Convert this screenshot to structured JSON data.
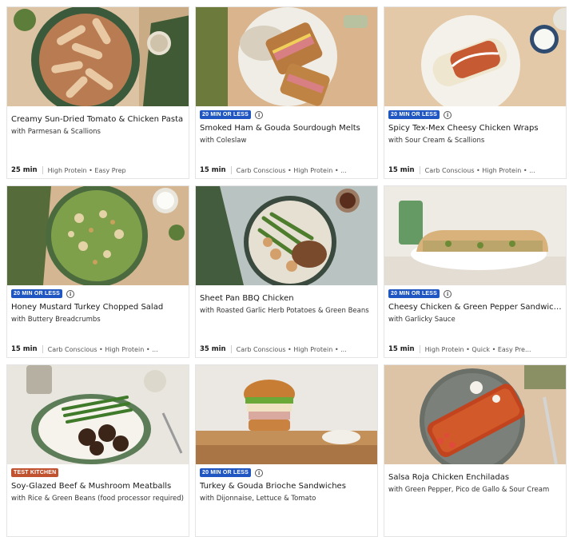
{
  "colors": {
    "badge_quick": "#1f56c2",
    "badge_test_kitchen": "#c0522f",
    "card_border": "#e4e4e4"
  },
  "cards": [
    {
      "title": "Creamy Sun-Dried Tomato & Chicken Pasta",
      "subtitle": "with Parmesan & Scallions",
      "time": "25 min",
      "tags": "High Protein • Easy Prep",
      "badge": ""
    },
    {
      "title": "Smoked Ham & Gouda Sourdough Melts",
      "subtitle": "with Coleslaw",
      "time": "15 min",
      "tags": "Carb Conscious • High Protein • ...",
      "badge": "20 MIN OR LESS"
    },
    {
      "title": "Spicy Tex-Mex Cheesy Chicken Wraps",
      "subtitle": "with Sour Cream & Scallions",
      "time": "15 min",
      "tags": "Carb Conscious • High Protein • ...",
      "badge": "20 MIN OR LESS"
    },
    {
      "title": "Honey Mustard Turkey Chopped Salad",
      "subtitle": "with Buttery Breadcrumbs",
      "time": "15 min",
      "tags": "Carb Conscious • High Protein • ...",
      "badge": "20 MIN OR LESS"
    },
    {
      "title": "Sheet Pan BBQ Chicken",
      "subtitle": "with Roasted Garlic Herb Potatoes & Green Beans",
      "time": "35 min",
      "tags": "Carb Conscious • High Protein • ...",
      "badge": ""
    },
    {
      "title": "Cheesy Chicken & Green Pepper Sandwich...",
      "subtitle": "with Garlicky Sauce",
      "time": "15 min",
      "tags": "High Protein • Quick • Easy Pre...",
      "badge": "20 MIN OR LESS"
    },
    {
      "title": "Soy-Glazed Beef & Mushroom Meatballs",
      "subtitle": "with Rice & Green Beans (food processor required)",
      "time": "",
      "tags": "",
      "badge": "TEST KITCHEN"
    },
    {
      "title": "Turkey & Gouda Brioche Sandwiches",
      "subtitle": "with Dijonnaise, Lettuce & Tomato",
      "time": "",
      "tags": "",
      "badge": "20 MIN OR LESS"
    },
    {
      "title": "Salsa Roja Chicken Enchiladas",
      "subtitle": "with Green Pepper, Pico de Gallo & Sour Cream",
      "time": "",
      "tags": "",
      "badge": ""
    }
  ]
}
